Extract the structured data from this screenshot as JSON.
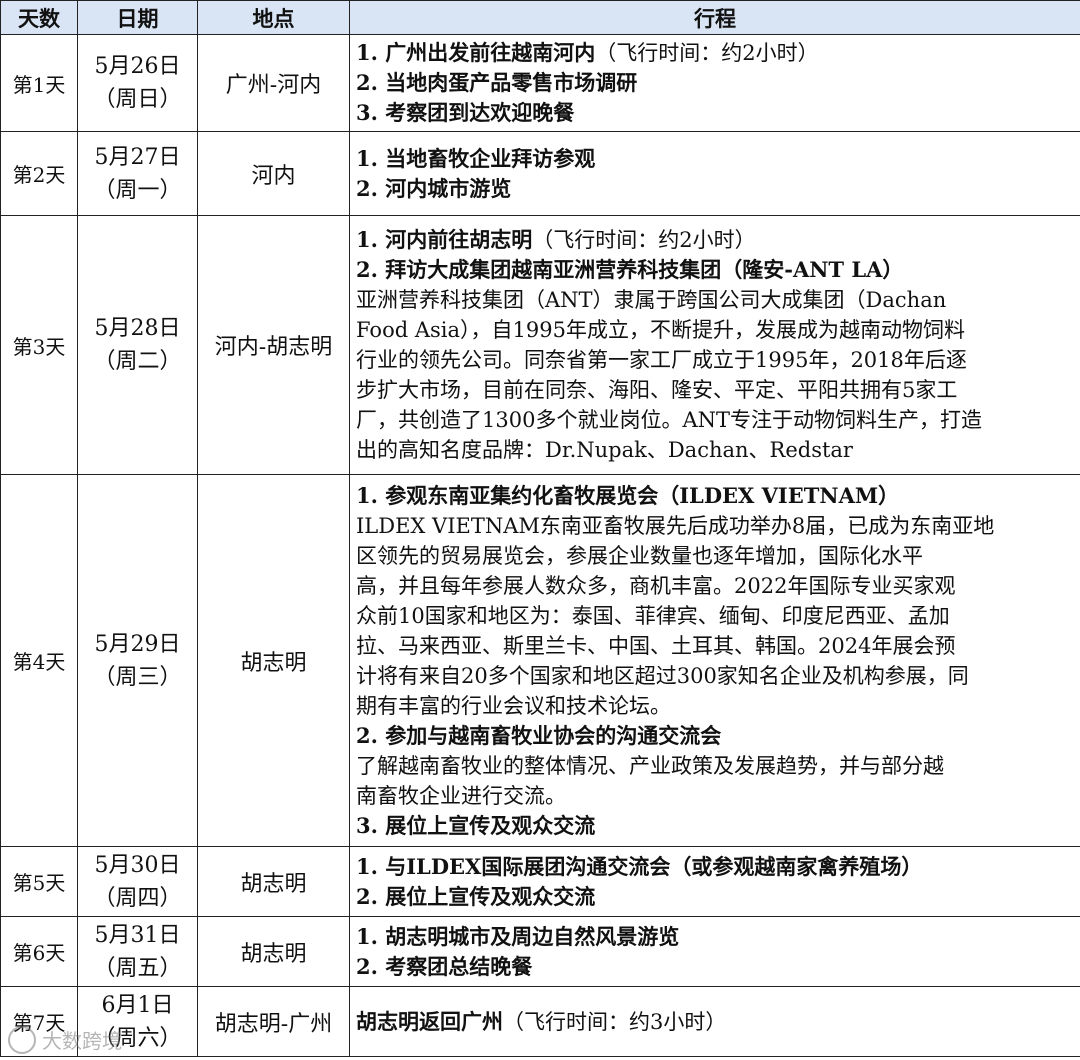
{
  "header": {
    "day": "天数",
    "date": "日期",
    "place": "地点",
    "schedule": "行程"
  },
  "rows": [
    {
      "day": "第1天",
      "date": "5月26日",
      "weekday": "（周日）",
      "place": "广州-河内",
      "lines": [
        {
          "bold": "1. 广州出发前往越南河内",
          "normal": "（飞行时间：约2小时）"
        },
        {
          "bold": "2. 当地肉蛋产品零售市场调研",
          "normal": ""
        },
        {
          "bold": "3. 考察团到达欢迎晚餐",
          "normal": ""
        }
      ]
    },
    {
      "day": "第2天",
      "date": "5月27日",
      "weekday": "（周一）",
      "place": "河内",
      "lines": [
        {
          "bold": "1. 当地畜牧企业拜访参观",
          "normal": ""
        },
        {
          "bold": "2. 河内城市游览",
          "normal": ""
        }
      ]
    },
    {
      "day": "第3天",
      "date": "5月28日",
      "weekday": "（周二）",
      "place": "河内-胡志明",
      "lines": [
        {
          "bold": "1. 河内前往胡志明",
          "normal": "（飞行时间：约2小时）"
        },
        {
          "bold": "2. 拜访大成集团越南亚洲营养科技集团（隆安-ANT LA）",
          "normal": ""
        },
        {
          "bold": "",
          "normal": "亚洲营养科技集团（ANT）隶属于跨国公司大成集团（Dachan"
        },
        {
          "bold": "",
          "normal": "Food Asia），自1995年成立，不断提升，发展成为越南动物饲料"
        },
        {
          "bold": "",
          "normal": "行业的领先公司。同奈省第一家工厂成立于1995年，2018年后逐"
        },
        {
          "bold": "",
          "normal": "步扩大市场，目前在同奈、海阳、隆安、平定、平阳共拥有5家工"
        },
        {
          "bold": "",
          "normal": "厂，共创造了1300多个就业岗位。ANT专注于动物饲料生产，打造"
        },
        {
          "bold": "",
          "normal": "出的高知名度品牌：Dr.Nupak、Dachan、Redstar"
        }
      ]
    },
    {
      "day": "第4天",
      "date": "5月29日",
      "weekday": "（周三）",
      "place": "胡志明",
      "lines": [
        {
          "bold": "1. 参观东南亚集约化畜牧展览会（ILDEX VIETNAM）",
          "normal": ""
        },
        {
          "bold": "",
          "normal": "ILDEX VIETNAM东南亚畜牧展先后成功举办8届，已成为东南亚地"
        },
        {
          "bold": "",
          "normal": "区领先的贸易展览会，参展企业数量也逐年增加，国际化水平"
        },
        {
          "bold": "",
          "normal": "高，并且每年参展人数众多，商机丰富。2022年国际专业买家观"
        },
        {
          "bold": "",
          "normal": "众前10国家和地区为：泰国、菲律宾、缅甸、印度尼西亚、孟加"
        },
        {
          "bold": "",
          "normal": "拉、马来西亚、斯里兰卡、中国、土耳其、韩国。2024年展会预"
        },
        {
          "bold": "",
          "normal": "计将有来自20多个国家和地区超过300家知名企业及机构参展，同"
        },
        {
          "bold": "",
          "normal": "期有丰富的行业会议和技术论坛。"
        },
        {
          "bold": "2. 参加与越南畜牧业协会的沟通交流会",
          "normal": ""
        },
        {
          "bold": "",
          "normal": "了解越南畜牧业的整体情况、产业政策及发展趋势，并与部分越"
        },
        {
          "bold": "",
          "normal": "南畜牧企业进行交流。"
        },
        {
          "bold": "3. 展位上宣传及观众交流",
          "normal": ""
        }
      ]
    },
    {
      "day": "第5天",
      "date": "5月30日",
      "weekday": "（周四）",
      "place": "胡志明",
      "lines": [
        {
          "bold": "1. 与ILDEX国际展团沟通交流会（或参观越南家禽养殖场）",
          "normal": ""
        },
        {
          "bold": "2. 展位上宣传及观众交流",
          "normal": ""
        }
      ]
    },
    {
      "day": "第6天",
      "date": "5月31日",
      "weekday": "（周五）",
      "place": "胡志明",
      "lines": [
        {
          "bold": "1. 胡志明城市及周边自然风景游览",
          "normal": ""
        },
        {
          "bold": "2. 考察团总结晚餐",
          "normal": ""
        }
      ]
    },
    {
      "day": "第7天",
      "date": "6月1日",
      "weekday": "（周六）",
      "place": "胡志明-广州",
      "lines": [
        {
          "bold": "胡志明返回广州",
          "normal": "（飞行时间：约3小时）"
        }
      ]
    }
  ],
  "watermark": {
    "text": "大数跨境",
    "icon": "watermark-logo-icon"
  }
}
